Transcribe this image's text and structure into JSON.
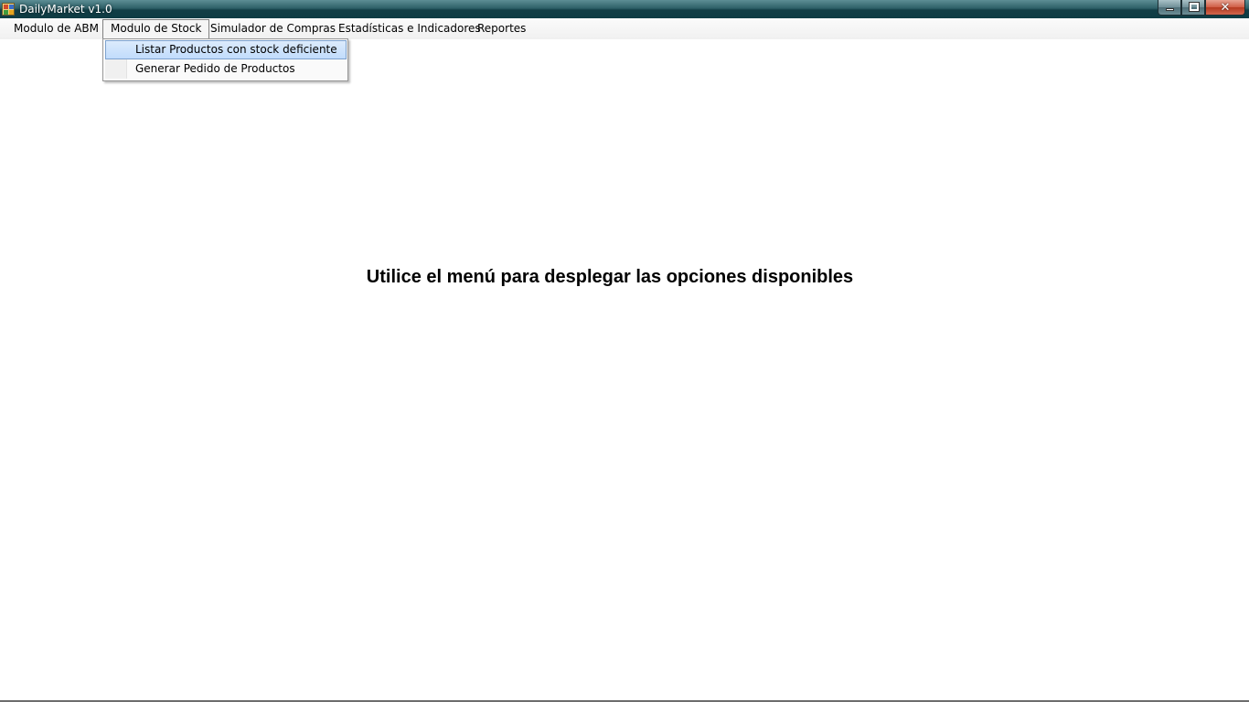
{
  "window": {
    "title": "DailyMarket v1.0",
    "controls": {
      "minimize": "minimize",
      "maximize": "restore",
      "close": "✕"
    }
  },
  "menubar": {
    "items": [
      {
        "label": "Modulo de ABM"
      },
      {
        "label": "Modulo de Stock"
      },
      {
        "label": "Simulador de Compras"
      },
      {
        "label": "Estadísticas e Indicadores"
      },
      {
        "label": "Reportes"
      }
    ]
  },
  "dropdown": {
    "parent": "Modulo de Stock",
    "items": [
      {
        "label": "Listar Productos con stock deficiente"
      },
      {
        "label": "Generar Pedido de Productos"
      }
    ]
  },
  "main": {
    "message": "Utilice el menú para desplegar las opciones disponibles"
  },
  "colors": {
    "titlebar": "#0e3c44",
    "highlight": "#c1dcfc",
    "highlight_border": "#7da2ce"
  }
}
